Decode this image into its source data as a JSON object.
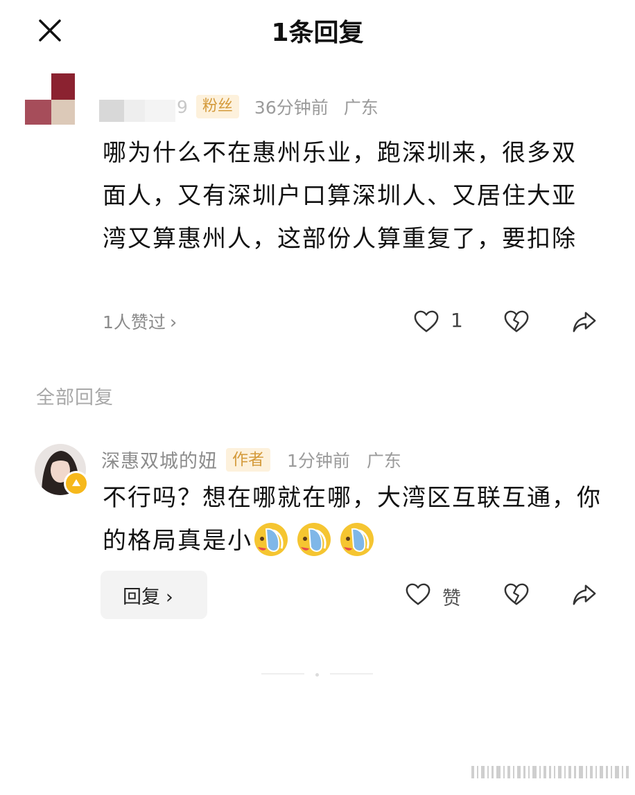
{
  "header": {
    "title": "1条回复"
  },
  "comment": {
    "name_tail": "9",
    "badge": "粉丝",
    "time": "36分钟前",
    "location": "广东",
    "text": "哪为什么不在惠州乐业，跑深圳来，很多双面人，又有深圳户口算深圳人、又居住大亚湾又算惠州人，这部份人算重复了，要扣除",
    "likers_label": "1人赞过",
    "like_count": "1"
  },
  "section_label": "全部回复",
  "reply": {
    "name": "深惠双城的妞",
    "badge": "作者",
    "time": "1分钟前",
    "location": "广东",
    "text": "不行吗？想在哪就在哪，大湾区互联互通，你的格局真是小",
    "emojis": [
      "flip-flop-emoji",
      "flip-flop-emoji",
      "flip-flop-emoji"
    ],
    "reply_button": "回复",
    "like_label": "赞"
  },
  "icons": {
    "close": "close-icon",
    "heart": "heart-icon",
    "broken_heart": "broken-heart-icon",
    "share": "share-icon",
    "chevron": "chevron-right-icon"
  },
  "colors": {
    "badge_bg": "#fdf1dc",
    "badge_text": "#d49a3b",
    "vip": "#f6b81c"
  }
}
